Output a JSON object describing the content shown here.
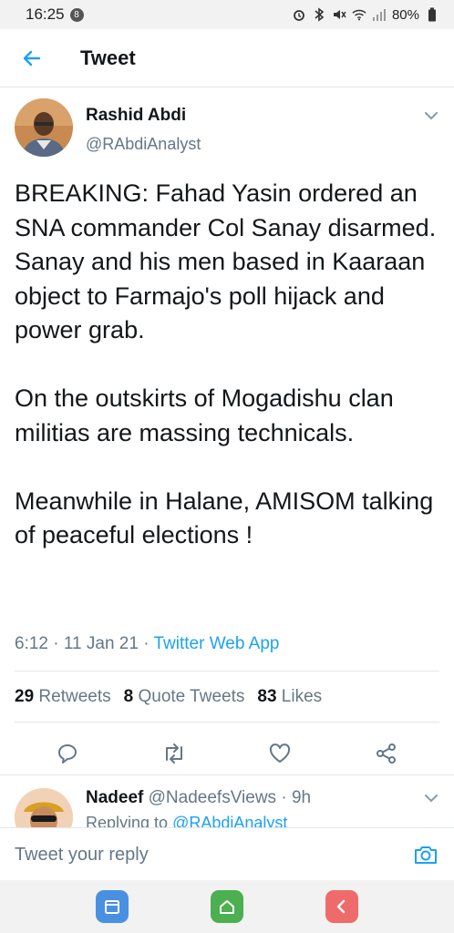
{
  "status_bar": {
    "time": "16:25",
    "notification_count": "8",
    "battery": "80%"
  },
  "header": {
    "title": "Tweet"
  },
  "tweet": {
    "author_name": "Rashid Abdi",
    "author_handle": "@RAbdiAnalyst",
    "text": "BREAKING: Fahad Yasin ordered an SNA commander Col Sanay disarmed. Sanay and his men based in Kaaraan object to Farmajo's poll hijack and power grab.\n\nOn the outskirts of Mogadishu clan militias are massing technicals.\n\nMeanwhile in Halane, AMISOM talking of peaceful elections !",
    "time": "6:12",
    "date": "11 Jan 21",
    "source": "Twitter Web App",
    "retweets_count": "29",
    "retweets_label": "Retweets",
    "quotes_count": "8",
    "quotes_label": "Quote Tweets",
    "likes_count": "83",
    "likes_label": "Likes"
  },
  "reply": {
    "name": "Nadeef",
    "handle": "@NadeefsViews",
    "age": "9h",
    "replying_prefix": "Replying to",
    "replying_to": "@RAbdiAnalyst"
  },
  "compose": {
    "placeholder": "Tweet your reply"
  },
  "colors": {
    "accent": "#1da1f2",
    "secondary_text": "#657786",
    "divider": "#e1e8ed"
  }
}
